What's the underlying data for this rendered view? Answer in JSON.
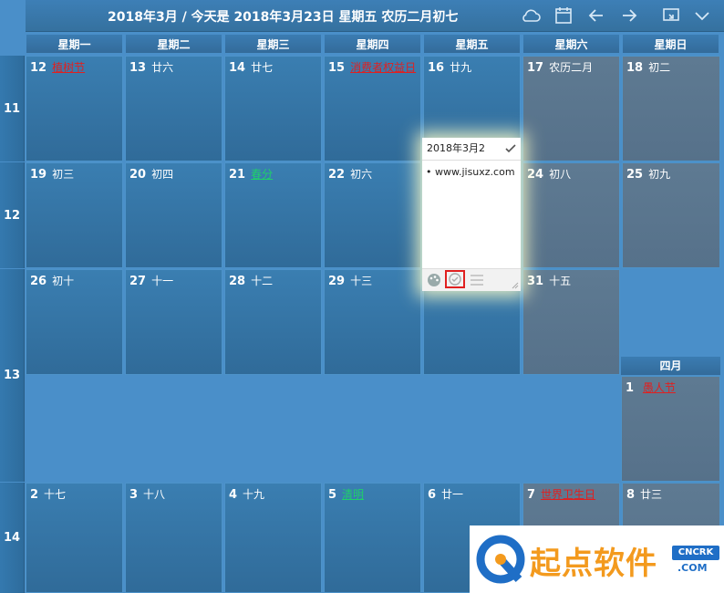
{
  "header": {
    "title": "2018年3月 / 今天是 2018年3月23日 星期五 农历二月初七",
    "icons": [
      "cloud-icon",
      "calendar-icon",
      "arrow-left-icon",
      "arrow-right-icon",
      "window-icon",
      "chevron-down-icon"
    ]
  },
  "weekdays": [
    "星期一",
    "星期二",
    "星期三",
    "星期四",
    "星期五",
    "星期六",
    "星期日"
  ],
  "week_numbers": [
    "11",
    "12",
    "13",
    "14"
  ],
  "rows": [
    [
      {
        "day": "12",
        "lunar": "植树节",
        "style": "red"
      },
      {
        "day": "13",
        "lunar": "廿六",
        "style": ""
      },
      {
        "day": "14",
        "lunar": "廿七",
        "style": ""
      },
      {
        "day": "15",
        "lunar": "消费者权益日",
        "style": "red"
      },
      {
        "day": "16",
        "lunar": "廿九",
        "style": ""
      },
      {
        "day": "17",
        "lunar": "农历二月",
        "style": "",
        "gray": true
      },
      {
        "day": "18",
        "lunar": "初二",
        "style": "",
        "gray": true
      }
    ],
    [
      {
        "day": "19",
        "lunar": "初三",
        "style": ""
      },
      {
        "day": "20",
        "lunar": "初四",
        "style": ""
      },
      {
        "day": "21",
        "lunar": "春分",
        "style": "green"
      },
      {
        "day": "22",
        "lunar": "初六",
        "style": ""
      },
      {
        "day": "",
        "lunar": "",
        "style": ""
      },
      {
        "day": "24",
        "lunar": "初八",
        "style": "",
        "gray": true
      },
      {
        "day": "25",
        "lunar": "初九",
        "style": "",
        "gray": true
      }
    ],
    [
      {
        "day": "26",
        "lunar": "初十",
        "style": ""
      },
      {
        "day": "27",
        "lunar": "十一",
        "style": ""
      },
      {
        "day": "28",
        "lunar": "十二",
        "style": ""
      },
      {
        "day": "29",
        "lunar": "十三",
        "style": ""
      },
      {
        "day": "",
        "lunar": "",
        "style": ""
      },
      {
        "day": "31",
        "lunar": "十五",
        "style": "",
        "gray": true
      }
    ],
    [
      {
        "day": "2",
        "lunar": "十七",
        "style": ""
      },
      {
        "day": "3",
        "lunar": "十八",
        "style": ""
      },
      {
        "day": "4",
        "lunar": "十九",
        "style": ""
      },
      {
        "day": "5",
        "lunar": "清明",
        "style": "green"
      },
      {
        "day": "6",
        "lunar": "廿一",
        "style": ""
      },
      {
        "day": "7",
        "lunar": "世界卫生日",
        "style": "red",
        "gray": true
      },
      {
        "day": "8",
        "lunar": "廿三",
        "style": "",
        "gray": true
      }
    ]
  ],
  "april": {
    "label": "四月",
    "day": "1",
    "lunar": "愚人节"
  },
  "popup": {
    "date": "2018年3月2",
    "note": "• www.jisuxz.com"
  },
  "watermark": {
    "brand": "起点软件",
    "badge": "CNCRK",
    "domain": ".COM"
  }
}
